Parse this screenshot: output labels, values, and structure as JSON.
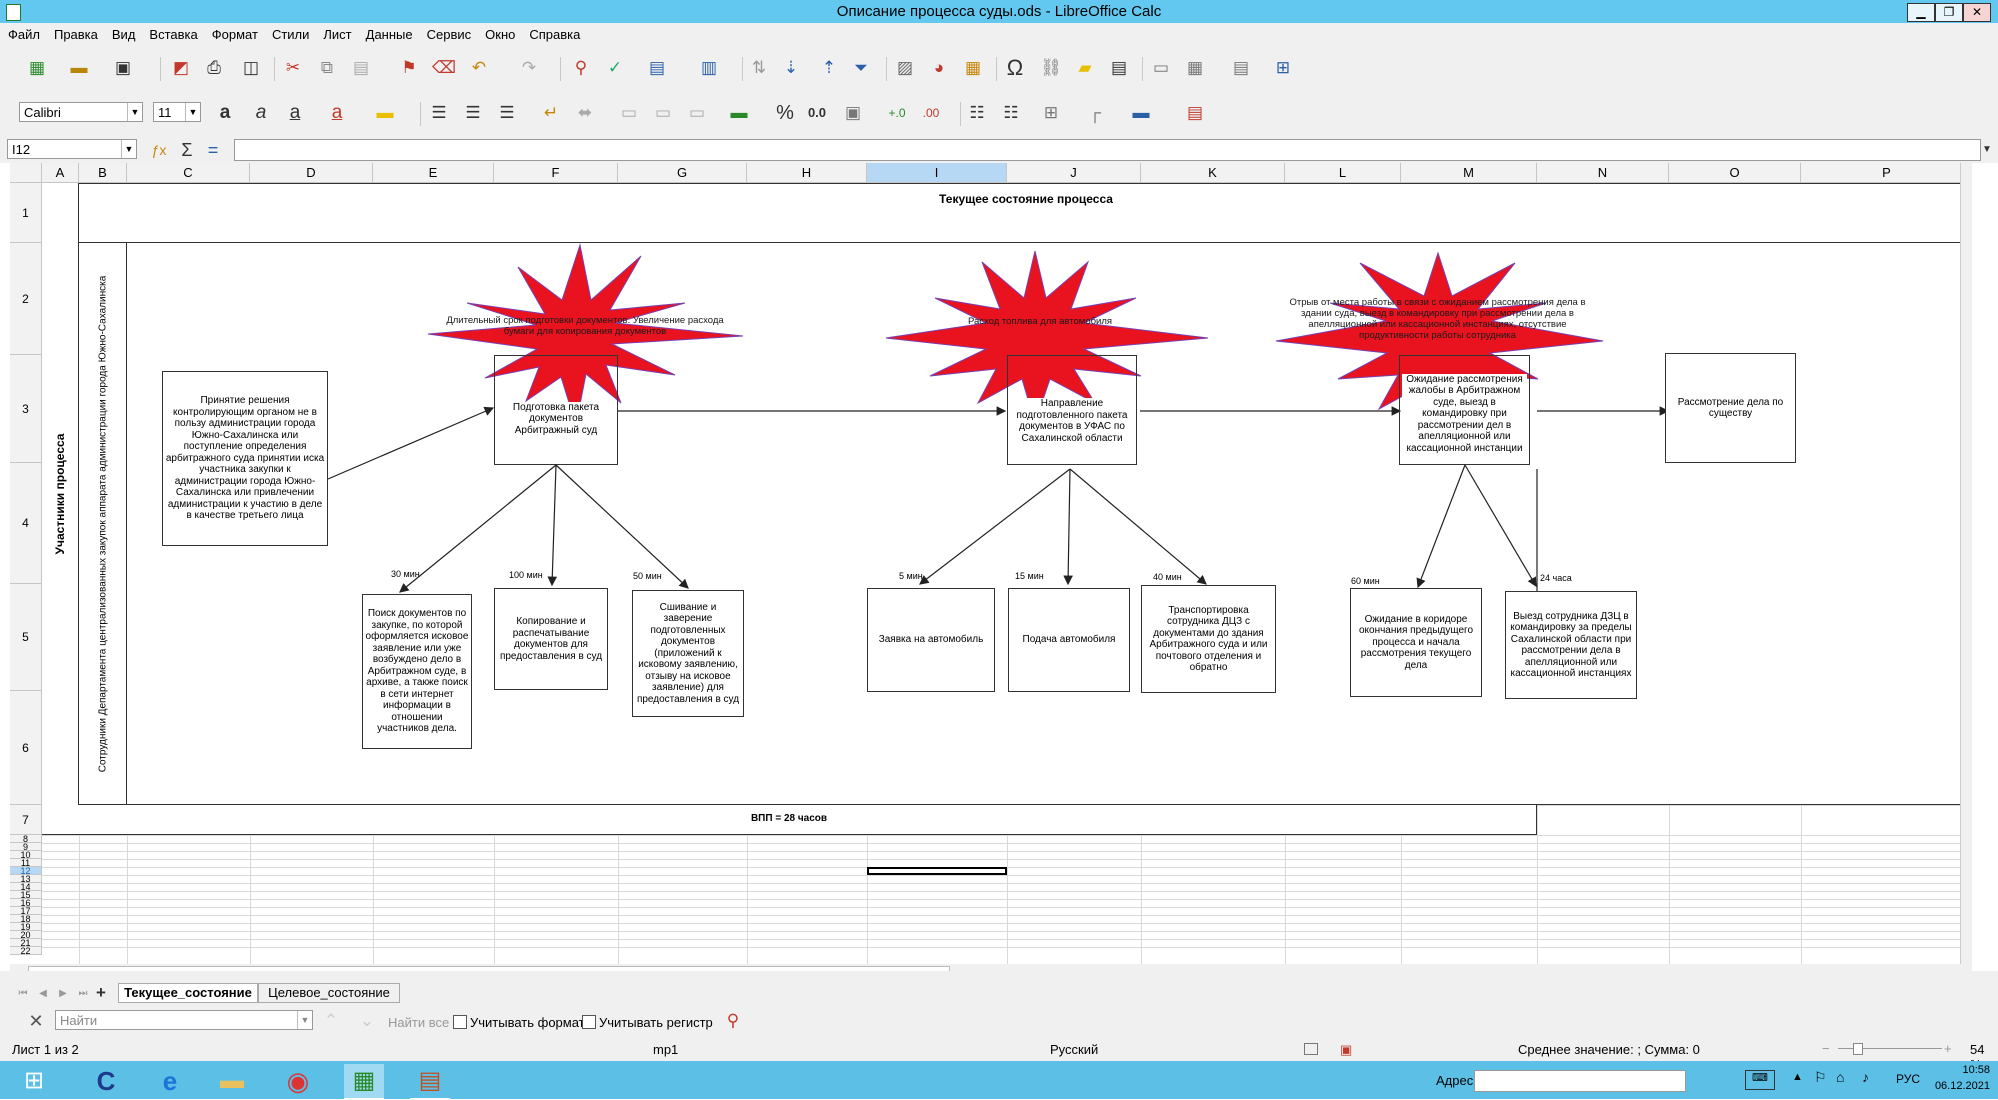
{
  "window": {
    "title": "Описание процесса суды.ods - LibreOffice Calc",
    "minimize": "▁",
    "restore": "❐",
    "close": "✕"
  },
  "menu": [
    "Файл",
    "Правка",
    "Вид",
    "Вставка",
    "Формат",
    "Стили",
    "Лист",
    "Данные",
    "Сервис",
    "Окно",
    "Справка"
  ],
  "font": {
    "name": "Calibri",
    "size": "11"
  },
  "name_box": "I12",
  "columns": [
    "A",
    "B",
    "C",
    "D",
    "E",
    "F",
    "G",
    "H",
    "I",
    "J",
    "K",
    "L",
    "M",
    "N",
    "O",
    "P"
  ],
  "rows": [
    "1",
    "2",
    "3",
    "4",
    "5",
    "6",
    "7",
    "8",
    "9",
    "10",
    "11",
    "12",
    "13",
    "14",
    "15",
    "16",
    "17",
    "18",
    "19",
    "20",
    "21",
    "22"
  ],
  "sheet": {
    "header": "Текущее состояние процесса",
    "participants_label": "Участники процесса",
    "department_label": "Сотрудники Департамента централизованных закупок аппарата администрации города Южно-Сахалинска",
    "total": "ВПП = 28 часов",
    "boxes": {
      "decision": "Принятие решения контролирующим органом не в пользу администрации города Южно-Сахалинска или поступление определения арбитражного суда принятии иска участника закупки к администрации города Южно-Сахалинска или привлечении администрации к участию в деле в качестве третьего лица",
      "prepare": "Подготовка пакета документов Арбитражный суд",
      "search": "Поиск документов по закупке, по которой оформляется исковое заявление или уже возбуждено дело в Арбитражном суде, в архиве, а также поиск в сети интернет информации в отношении участников дела.",
      "copy": "Копирование и распечатывание документов для предоставления в суд",
      "stitch": "Сшивание и заверение подготовленных документов (приложений к исковому заявлению, отзыву на исковое заявление) для предоставления в суд",
      "send": "Направление подготовленного пакета документов в УФАС по Сахалинской области",
      "car_request": "Заявка на автомобиль",
      "car_supply": "Подача автомобиля",
      "transport": "Транспортировка сотрудника ДЦЗ с документами до здания Арбитражного суда и или почтового отделения и обратно",
      "waiting": "Ожидание рассмотрения жалобы в Арбитражном суде, выезд в командировку при рассмотрении дел в апелляционной или кассационной инстанции",
      "review": "Рассмотрение дела по существу",
      "corridor": "Ожидание в коридоре окончания предыдущего процесса и начала рассмотрения текущего дела",
      "trip": "Выезд сотрудника ДЗЦ в командировку за пределы Сахалинской области при рассмотрении дела в апелляционной или кассационной инстанциях"
    },
    "times": {
      "search": "30 мин",
      "copy": "100 мин",
      "stitch": "50 мин",
      "car_request": "5 мин",
      "car_supply": "15 мин",
      "transport": "40 мин",
      "corridor": "60 мин",
      "trip": "24 часа"
    },
    "problems": {
      "p1": "Длительный срок подготовки документов. Увеличение расхода бумаги для копирования документов",
      "p2": "Расход топлива для автомобиля",
      "p3": "Отрыв от места работы в связи с ожиданием рассмотрения дела в здании суда, выезд в командировку при рассмотрении дела в апелляционной или кассационной инстанциях, отсутствие продуктивности работы сотрудника"
    },
    "star_color": "#e8131f"
  },
  "tabs": {
    "active": "Текущее_состояние",
    "other": "Целевое_состояние"
  },
  "find": {
    "placeholder": "Найти",
    "find_all": "Найти все",
    "match_format": "Учитывать формат",
    "match_case": "Учитывать регистр"
  },
  "status": {
    "sheet": "Лист 1 из 2",
    "style": "mp1",
    "language": "Русский",
    "summary": "Среднее значение: ; Сумма: 0",
    "zoom": "54 %"
  },
  "taskbar": {
    "address_label": "Адрес",
    "lang": "РУС",
    "time": "10:58",
    "date": "06.12.2021"
  }
}
